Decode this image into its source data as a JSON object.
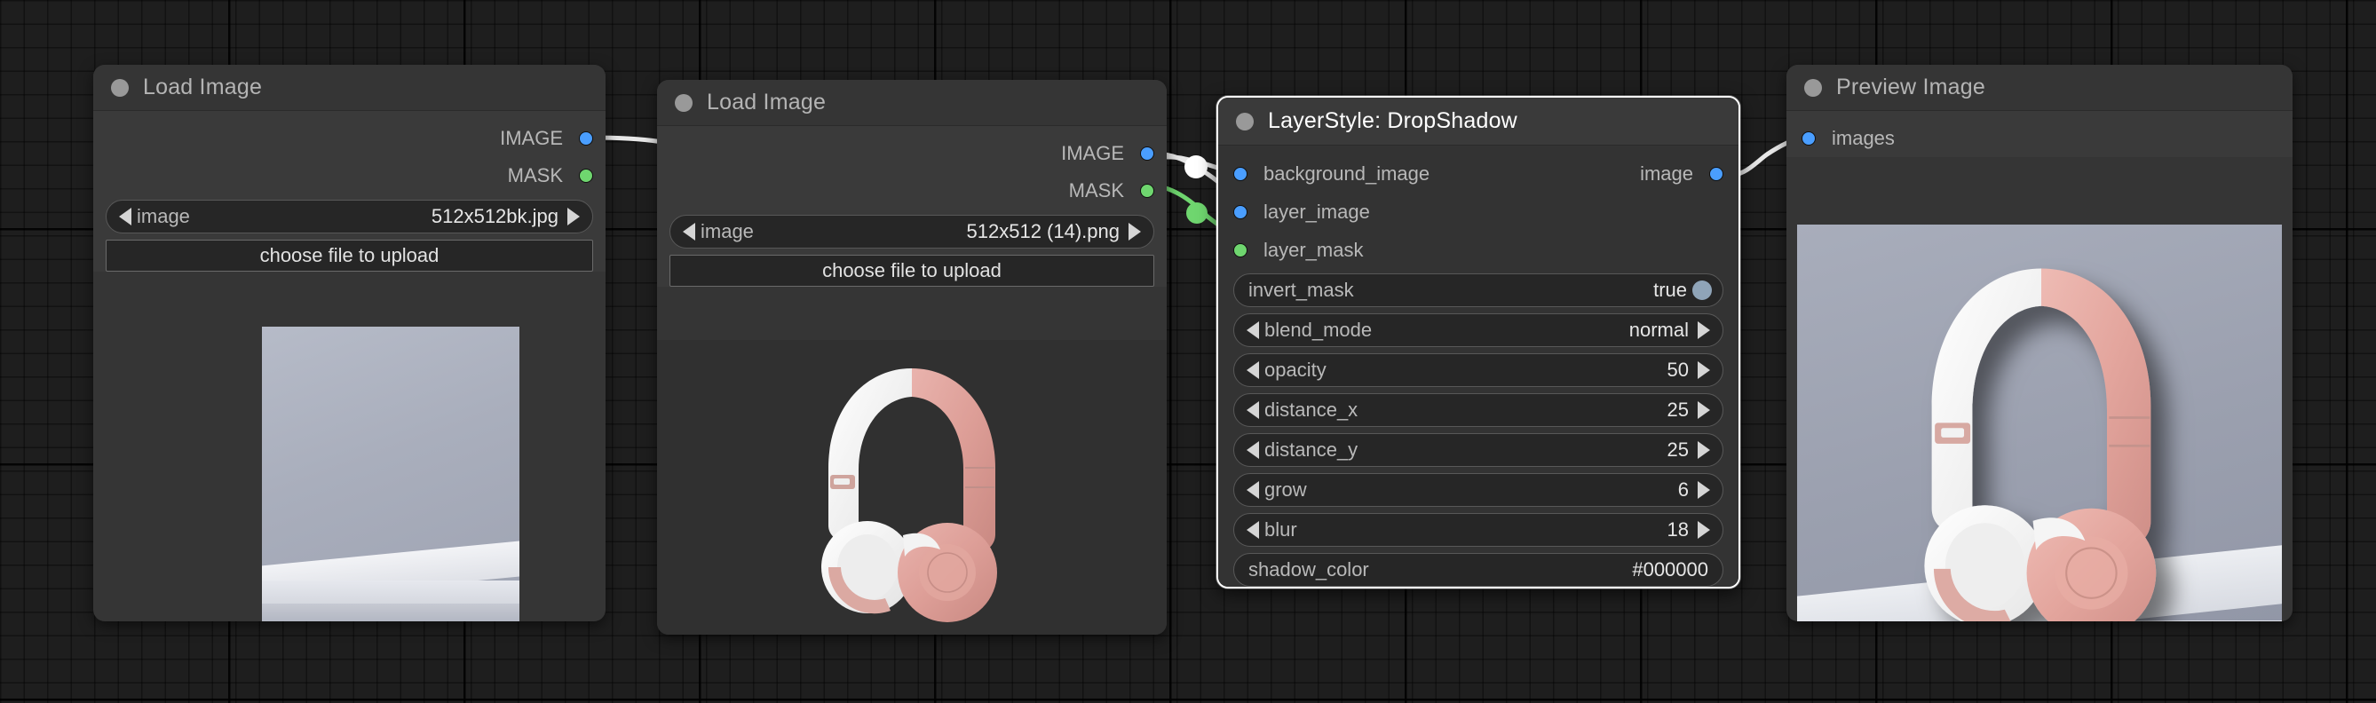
{
  "app": {
    "canvas_background": "#1e1e1e",
    "link_color": "#e8e8e8",
    "link_mask_color": "#6fd66f",
    "slot_image_color": "#4a9eff",
    "slot_mask_color": "#6fd66f"
  },
  "nodes": [
    {
      "id": "load-image-1",
      "title": "Load Image",
      "outputs": [
        {
          "label": "IMAGE",
          "type": "IMAGE"
        },
        {
          "label": "MASK",
          "type": "MASK"
        }
      ],
      "widgets": [
        {
          "kind": "combo",
          "name": "image",
          "value": "512x512bk.jpg"
        },
        {
          "kind": "button",
          "label": "choose file to upload"
        }
      ],
      "preview_alt": "empty gray studio scene with white podium"
    },
    {
      "id": "load-image-2",
      "title": "Load Image",
      "outputs": [
        {
          "label": "IMAGE",
          "type": "IMAGE"
        },
        {
          "label": "MASK",
          "type": "MASK"
        }
      ],
      "widgets": [
        {
          "kind": "combo",
          "name": "image",
          "value": "512x512 (14).png"
        },
        {
          "kind": "button",
          "label": "choose file to upload"
        }
      ],
      "preview_alt": "rose gold headphones on dark background"
    },
    {
      "id": "layerstyle-dropshadow",
      "title": "LayerStyle: DropShadow",
      "selected": true,
      "inputs": [
        {
          "label": "background_image",
          "type": "IMAGE"
        },
        {
          "label": "layer_image",
          "type": "IMAGE"
        },
        {
          "label": "layer_mask",
          "type": "MASK"
        }
      ],
      "outputs": [
        {
          "label": "image",
          "type": "IMAGE"
        }
      ],
      "widgets": [
        {
          "kind": "toggle",
          "name": "invert_mask",
          "value": "true"
        },
        {
          "kind": "combo",
          "name": "blend_mode",
          "value": "normal"
        },
        {
          "kind": "number",
          "name": "opacity",
          "value": "50"
        },
        {
          "kind": "number",
          "name": "distance_x",
          "value": "25"
        },
        {
          "kind": "number",
          "name": "distance_y",
          "value": "25"
        },
        {
          "kind": "number",
          "name": "grow",
          "value": "6"
        },
        {
          "kind": "number",
          "name": "blur",
          "value": "18"
        },
        {
          "kind": "text",
          "name": "shadow_color",
          "value": "#000000"
        }
      ]
    },
    {
      "id": "preview-image",
      "title": "Preview Image",
      "inputs": [
        {
          "label": "images",
          "type": "IMAGE"
        }
      ],
      "widgets": [],
      "preview_alt": "rose gold headphones composited on gray podium with drop shadow"
    }
  ]
}
